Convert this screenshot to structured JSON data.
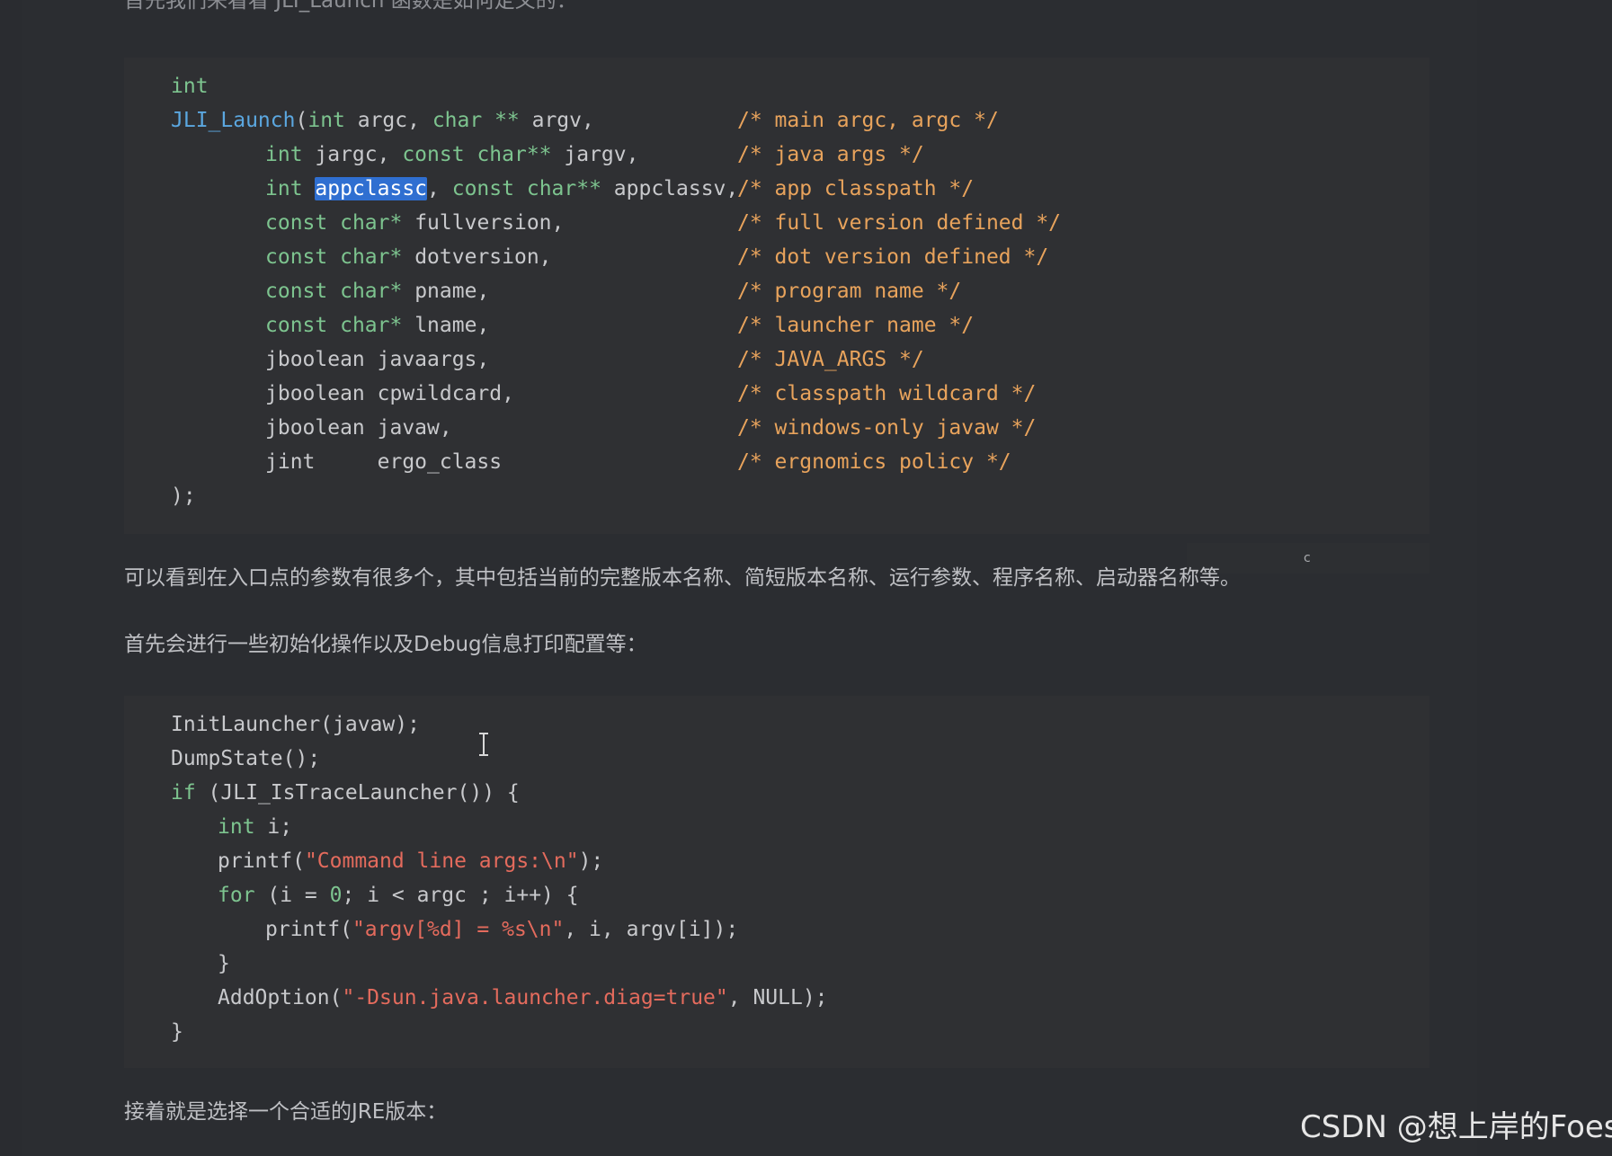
{
  "text": {
    "top_cut": "首先我们来看看 JLI_Launch 函数是如何定义的：",
    "para_params": "可以看到在入口点的参数有很多个，其中包括当前的完整版本名称、简短版本名称、运行参数、程序名称、启动器名称等。",
    "para_init": "首先会进行一些初始化操作以及Debug信息打印配置等：",
    "para_jre": "接着就是选择一个合适的JRE版本："
  },
  "code1": {
    "l1": {
      "t0": "int"
    },
    "l2": {
      "t0": "JLI_Launch",
      "t1": "(",
      "t2": "int",
      "t3": " argc, ",
      "t4": "char",
      "t5": " ** ",
      "t6": "argv,",
      "c": "/* main argc, argc */"
    },
    "l3": {
      "t0": "int",
      "t1": " jargc, ",
      "t2": "const",
      "t3": " ",
      "t4": "char**",
      "t5": " jargv,",
      "c": "/* java args */"
    },
    "l4": {
      "t0": "int",
      "t1": " ",
      "t2": "appclassc",
      "t3": ", ",
      "t4": "const",
      "t5": " ",
      "t6": "char**",
      "t7": " appclassv,",
      "c": "/* app classpath */"
    },
    "l5": {
      "t0": "const",
      "t1": " ",
      "t2": "char*",
      "t3": " fullversion,",
      "c": "/* full version defined */"
    },
    "l6": {
      "t0": "const",
      "t1": " ",
      "t2": "char*",
      "t3": " dotversion,",
      "c": "/* dot version defined */"
    },
    "l7": {
      "t0": "const",
      "t1": " ",
      "t2": "char*",
      "t3": " pname,",
      "c": "/* program name */"
    },
    "l8": {
      "t0": "const",
      "t1": " ",
      "t2": "char*",
      "t3": " lname,",
      "c": "/* launcher name */"
    },
    "l9": {
      "t0": "jboolean javaargs,",
      "c": "/* JAVA_ARGS */"
    },
    "l10": {
      "t0": "jboolean cpwildcard,",
      "c": "/* classpath wildcard */"
    },
    "l11": {
      "t0": "jboolean javaw,",
      "c": "/* windows-only javaw */"
    },
    "l12": {
      "t0": "jint     ergo_class",
      "c": "/* ergnomics policy */"
    },
    "l13": {
      "t0": ");"
    }
  },
  "code2": {
    "l1": {
      "t0": "InitLauncher(javaw);"
    },
    "l2": {
      "t0": "DumpState();"
    },
    "l3": {
      "t0": "if",
      "t1": " (JLI_IsTraceLauncher()) {"
    },
    "l4": {
      "t0": "int",
      "t1": " i;"
    },
    "l5": {
      "t0": "printf(",
      "t1": "\"Command line args:\\n\"",
      "t2": ");"
    },
    "l6": {
      "t0": "for",
      "t1": " (i = ",
      "t2": "0",
      "t3": "; i < argc ; i++) {"
    },
    "l7": {
      "t0": "printf(",
      "t1": "\"argv[%d] = %s\\n\"",
      "t2": ", i, argv[i]);"
    },
    "l8": {
      "t0": "}"
    },
    "l9": {
      "t0": "AddOption(",
      "t1": "\"-Dsun.java.launcher.diag=true\"",
      "t2": ", NULL);"
    },
    "l10": {
      "t0": "}"
    }
  },
  "overlay": {
    "label": "c"
  },
  "watermark": {
    "text": "CSDN @想上岸的Foes"
  },
  "icons": {
    "cursor": "text-cursor-icon"
  }
}
